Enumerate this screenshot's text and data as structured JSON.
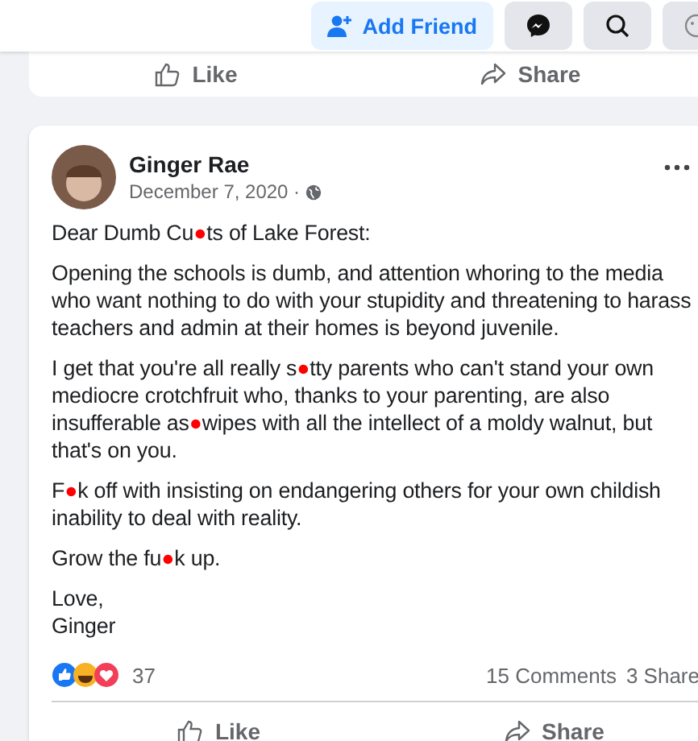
{
  "top_bar": {
    "add_friend": "Add Friend"
  },
  "previous_post": {
    "actions": [
      "Like",
      "Share"
    ]
  },
  "post": {
    "author": "Ginger Rae",
    "date": "December 7, 2020 ·",
    "paragraphs": [
      "Dear Dumb Cu●ts of Lake Forest:",
      "Opening the schools is dumb, and attention whoring to the media who want nothing to do with your stupidity and threatening to harass teachers and admin at their homes is beyond juvenile.",
      "I get that you're all really s●tty parents who can't stand your own mediocre crotchfruit who, thanks to your parenting, are also insufferable as●wipes with all the intellect of a moldy walnut, but that's on you.",
      "F●k off with insisting on endangering others for your own childish inability to deal with reality.",
      "Grow the fu●k up.",
      "Love,\nGinger"
    ],
    "reaction_count": "37",
    "comments": "15 Comments",
    "shares": "3 Share",
    "actions": [
      "Like",
      "Share"
    ]
  }
}
